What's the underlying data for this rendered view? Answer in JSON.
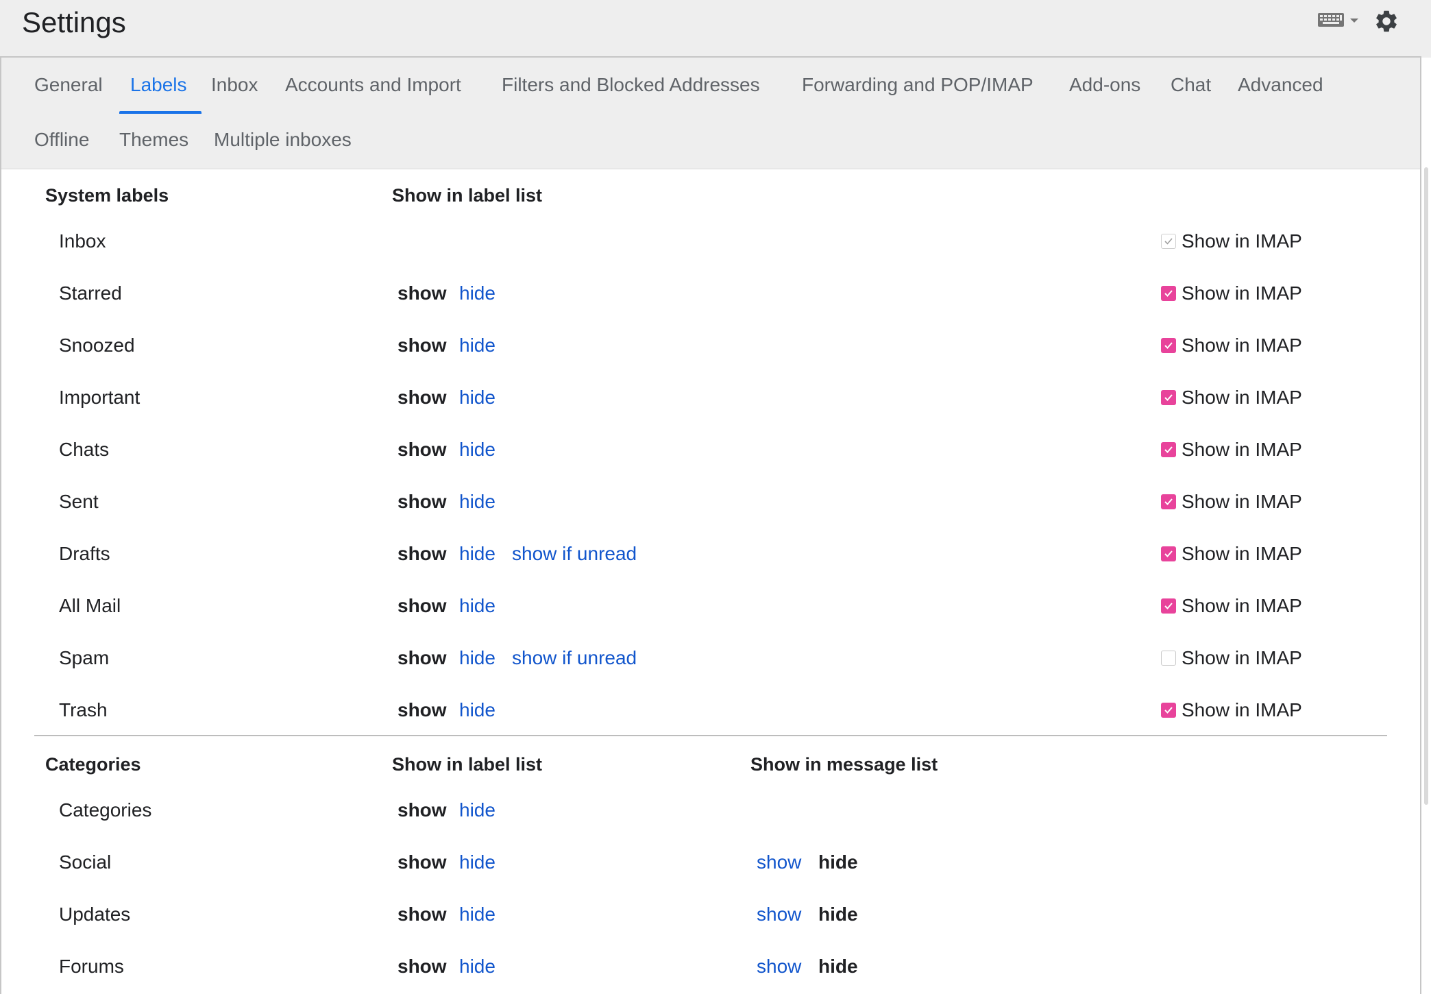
{
  "header": {
    "title": "Settings"
  },
  "tabs": [
    {
      "label": "General",
      "active": false
    },
    {
      "label": "Labels",
      "active": true
    },
    {
      "label": "Inbox",
      "active": false
    },
    {
      "label": "Accounts and Import",
      "active": false
    },
    {
      "label": "Filters and Blocked Addresses",
      "active": false
    },
    {
      "label": "Forwarding and POP/IMAP",
      "active": false
    },
    {
      "label": "Add-ons",
      "active": false
    },
    {
      "label": "Chat",
      "active": false
    },
    {
      "label": "Advanced",
      "active": false
    },
    {
      "label": "Offline",
      "active": false
    },
    {
      "label": "Themes",
      "active": false
    },
    {
      "label": "Multiple inboxes",
      "active": false
    }
  ],
  "system_labels": {
    "heading": "System labels",
    "col_label_list": "Show in label list",
    "imap_text": "Show in IMAP",
    "rows": [
      {
        "name": "Inbox",
        "show": "",
        "hide": "",
        "show_if_unread": "",
        "imap": "disabled"
      },
      {
        "name": "Starred",
        "show": "show",
        "hide": "hide",
        "show_if_unread": "",
        "imap": "checked"
      },
      {
        "name": "Snoozed",
        "show": "show",
        "hide": "hide",
        "show_if_unread": "",
        "imap": "checked"
      },
      {
        "name": "Important",
        "show": "show",
        "hide": "hide",
        "show_if_unread": "",
        "imap": "checked"
      },
      {
        "name": "Chats",
        "show": "show",
        "hide": "hide",
        "show_if_unread": "",
        "imap": "checked"
      },
      {
        "name": "Sent",
        "show": "show",
        "hide": "hide",
        "show_if_unread": "",
        "imap": "checked"
      },
      {
        "name": "Drafts",
        "show": "show",
        "hide": "hide",
        "show_if_unread": "show if unread",
        "imap": "checked"
      },
      {
        "name": "All Mail",
        "show": "show",
        "hide": "hide",
        "show_if_unread": "",
        "imap": "checked"
      },
      {
        "name": "Spam",
        "show": "show",
        "hide": "hide",
        "show_if_unread": "show if unread",
        "imap": "unchecked"
      },
      {
        "name": "Trash",
        "show": "show",
        "hide": "hide",
        "show_if_unread": "",
        "imap": "checked"
      }
    ]
  },
  "categories": {
    "heading": "Categories",
    "col_label_list": "Show in label list",
    "col_message_list": "Show in message list",
    "rows": [
      {
        "name": "Categories",
        "show": "show",
        "hide": "hide",
        "msg_show": "",
        "msg_hide": ""
      },
      {
        "name": "Social",
        "show": "show",
        "hide": "hide",
        "msg_show": "show",
        "msg_hide": "hide"
      },
      {
        "name": "Updates",
        "show": "show",
        "hide": "hide",
        "msg_show": "show",
        "msg_hide": "hide"
      },
      {
        "name": "Forums",
        "show": "show",
        "hide": "hide",
        "msg_show": "show",
        "msg_hide": "hide"
      }
    ]
  },
  "colors": {
    "accent": "#1a73e8",
    "link": "#1155cc",
    "checkbox": "#e8439b"
  },
  "icons": {
    "keyboard": "keyboard-icon",
    "dropdown": "chevron-down-icon",
    "settings": "gear-icon"
  }
}
